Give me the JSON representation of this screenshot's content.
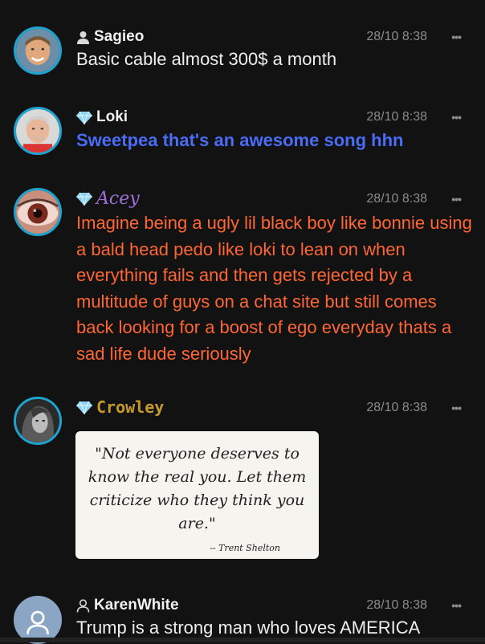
{
  "colors": {
    "background": "#121212",
    "avatar_border": "#1fa3cf",
    "timestamp": "#8c8c8c",
    "diamond": "#8fd3f4",
    "loki_text": "#4a6cf7",
    "acey_text": "#ff6633"
  },
  "messages": [
    {
      "name": "Sagieo",
      "badge_icon": "user-icon",
      "time": "28/10 8:38",
      "text": "Basic cable almost 300$ a month",
      "text_color": "#eeeeee"
    },
    {
      "name": "Loki",
      "badge_icon": "diamond-icon",
      "time": "28/10 8:38",
      "text": "Sweetpea that's an awesome song hhn",
      "text_color": "#4a6cf7"
    },
    {
      "name": "Acey",
      "badge_icon": "diamond-icon",
      "time": "28/10 8:38",
      "text": "Imagine being a ugly lil black boy like bonnie using a bald head pedo like loki to lean on when everything fails and then gets rejected by a multitude of guys on a chat site but still comes back looking for a boost of ego everyday thats a sad life dude seriously",
      "text_color": "#ff6633"
    },
    {
      "name": "Crowley",
      "badge_icon": "diamond-icon",
      "time": "28/10 8:38",
      "image_quote": "\"Not everyone deserves to know the real you. Let them criticize who they think you are.\"",
      "image_author": "-- Trent Shelton"
    },
    {
      "name": "KarenWhite",
      "badge_icon": "user-outline-icon",
      "time": "28/10 8:38",
      "text": "Trump is a strong man who loves AMERICA",
      "text_color": "#eeeeee"
    }
  ],
  "more_glyph": "•••"
}
